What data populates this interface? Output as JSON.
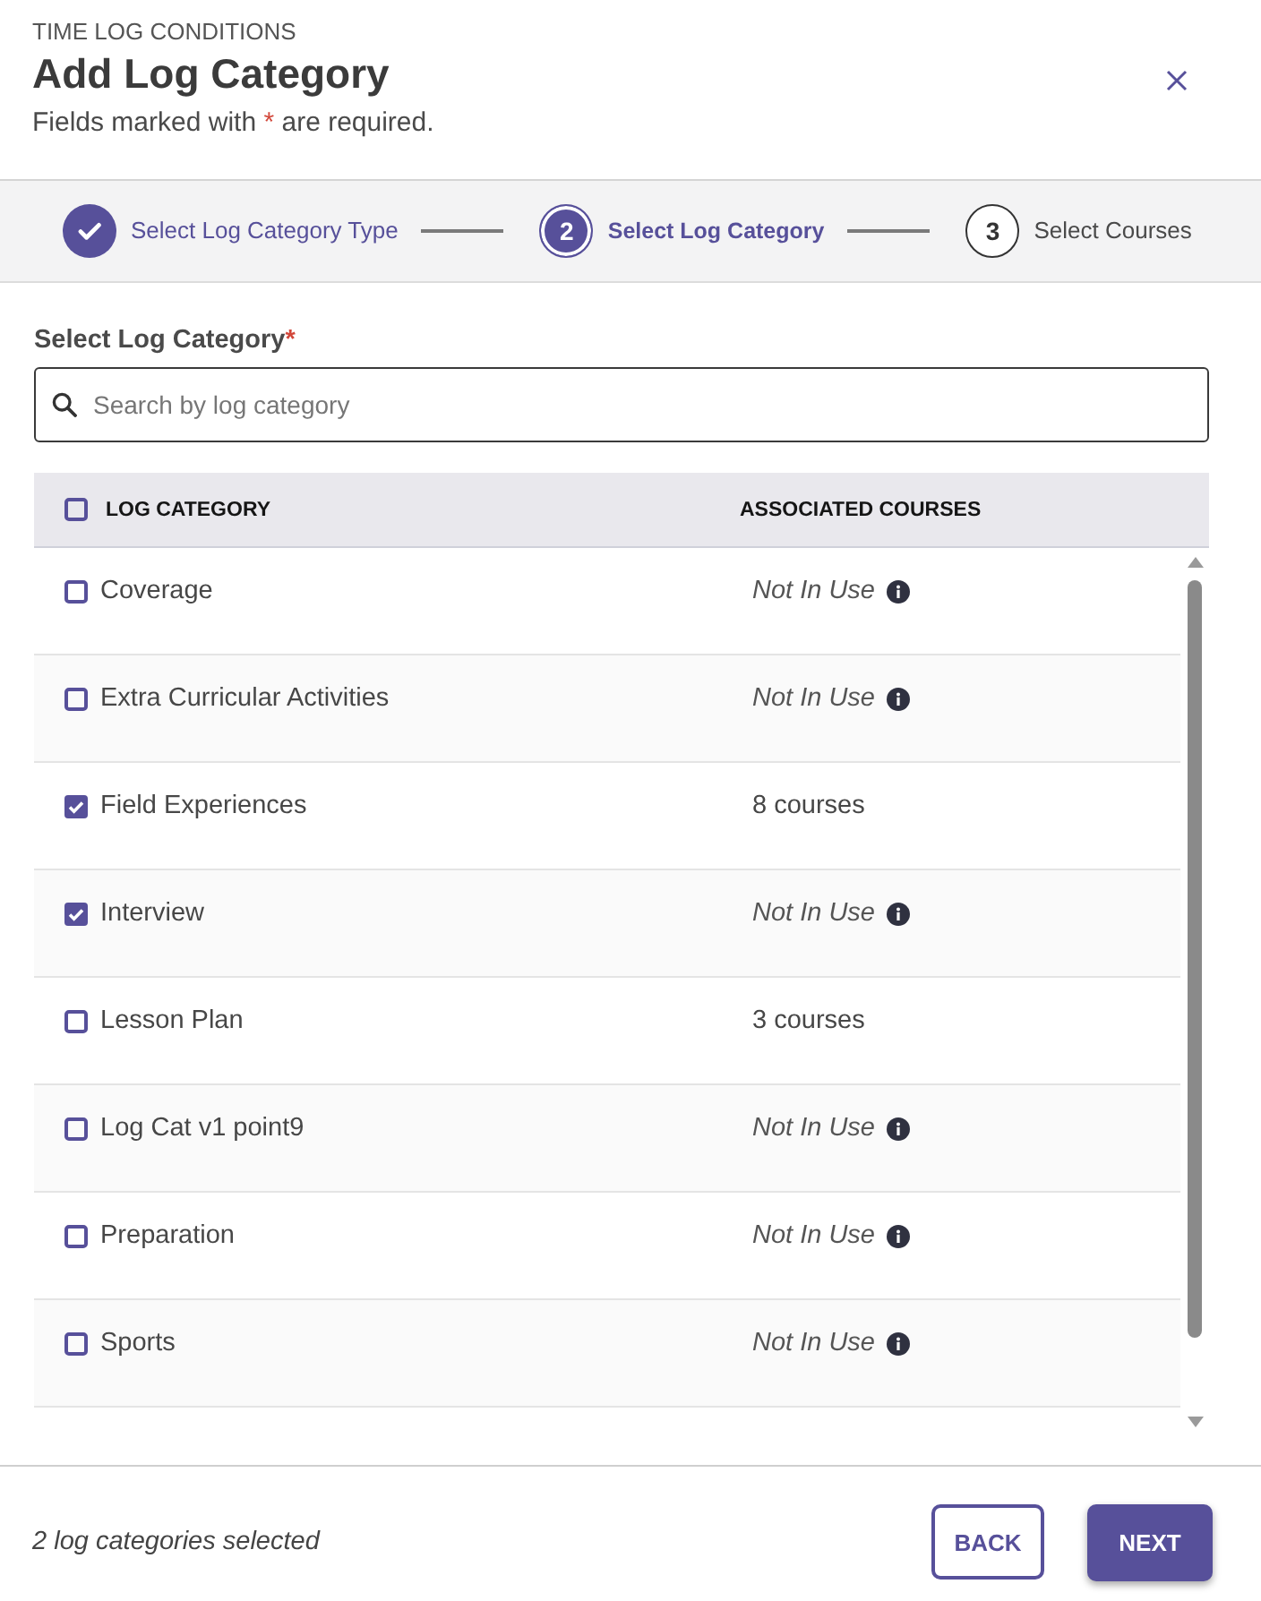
{
  "header": {
    "eyebrow": "TIME LOG CONDITIONS",
    "title": "Add Log Category",
    "required_note": {
      "before": "Fields marked with",
      "mark": "*",
      "after": "are required."
    }
  },
  "stepper": {
    "steps": [
      {
        "label": "Select Log Category Type",
        "completed": true,
        "selected": false
      },
      {
        "number": "2",
        "label": "Select Log Category",
        "completed": false,
        "selected": true
      },
      {
        "number": "3",
        "label": "Select Courses",
        "completed": false,
        "selected": false
      }
    ]
  },
  "category_field": {
    "label": "Select Log Category",
    "required_mark": "*",
    "placeholder": "Search by log category"
  },
  "table": {
    "select_all_checked": false,
    "columns": [
      "LOG CATEGORY",
      "ASSOCIATED COURSES"
    ],
    "rows": [
      {
        "name": "Coverage",
        "checked": false,
        "kind": "unused",
        "courses": "Not In Use"
      },
      {
        "name": "Extra Curricular Activities",
        "checked": false,
        "kind": "unused",
        "courses": "Not In Use"
      },
      {
        "name": "Field Experiences",
        "checked": true,
        "kind": "count",
        "courses": "8 courses"
      },
      {
        "name": "Interview",
        "checked": true,
        "kind": "unused",
        "courses": "Not In Use"
      },
      {
        "name": "Lesson Plan",
        "checked": false,
        "kind": "count",
        "courses": "3 courses"
      },
      {
        "name": "Log Cat v1 point9",
        "checked": false,
        "kind": "unused",
        "courses": "Not In Use"
      },
      {
        "name": "Preparation",
        "checked": false,
        "kind": "unused",
        "courses": "Not In Use"
      },
      {
        "name": "Sports",
        "checked": false,
        "kind": "unused",
        "courses": "Not In Use"
      }
    ]
  },
  "footer": {
    "selection_summary": "2 log categories selected",
    "buttons": [
      {
        "label": "BACK",
        "kind": "secondary"
      },
      {
        "label": "NEXT",
        "kind": "primary"
      }
    ]
  }
}
